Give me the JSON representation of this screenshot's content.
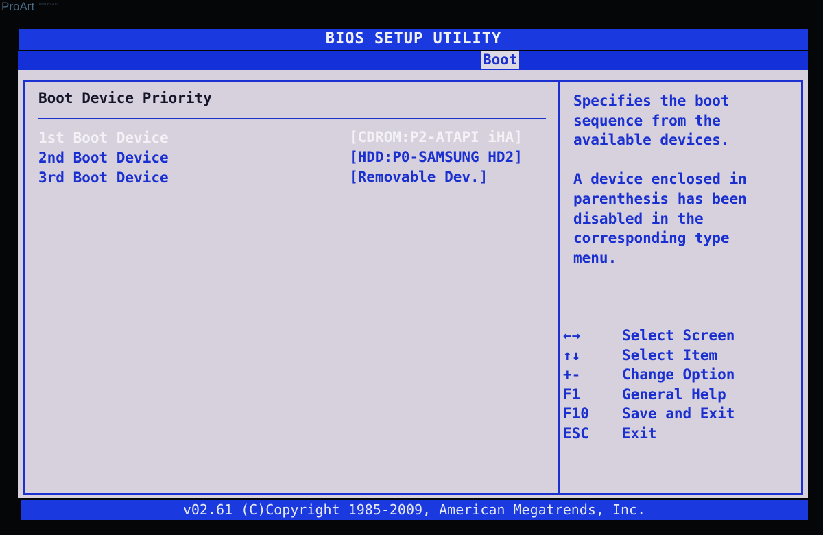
{
  "monitor": {
    "brand": "ProArt",
    "spec_line1": "1920 x 1200",
    "spec_line2": ""
  },
  "header": {
    "title": "BIOS SETUP UTILITY",
    "active_tab": "Boot"
  },
  "section": {
    "title": "Boot Device Priority",
    "options": [
      {
        "label": "1st Boot Device",
        "value": "[CDROM:P2-ATAPI iHA]",
        "selected": true
      },
      {
        "label": "2nd Boot Device",
        "value": "[HDD:P0-SAMSUNG HD2]",
        "selected": false
      },
      {
        "label": "3rd Boot Device",
        "value": "[Removable Dev.]",
        "selected": false
      }
    ]
  },
  "help": {
    "text": "Specifies the boot\nsequence from the\navailable devices.\n\nA device enclosed in\nparenthesis has been\ndisabled in the\ncorresponding type\nmenu."
  },
  "keys": [
    {
      "key": "←→",
      "action": "Select Screen"
    },
    {
      "key": "↑↓",
      "action": "Select Item"
    },
    {
      "key": "+-",
      "action": "Change Option"
    },
    {
      "key": "F1",
      "action": "General Help"
    },
    {
      "key": "F10",
      "action": "Save and Exit"
    },
    {
      "key": "ESC",
      "action": "Exit"
    }
  ],
  "footer": {
    "text": "v02.61 (C)Copyright 1985-2009, American Megatrends, Inc."
  },
  "colors": {
    "bar_blue": "#1a3ae0",
    "panel_bg": "#d7d1dd",
    "text_blue": "#1a2fd0",
    "selected_text": "#f4f2f6"
  }
}
